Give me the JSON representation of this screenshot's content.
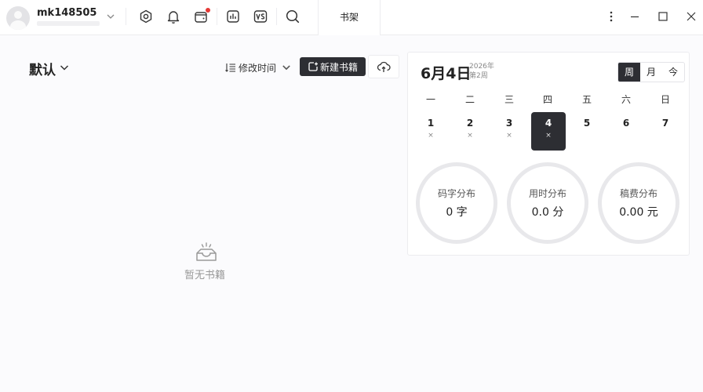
{
  "header": {
    "username": "mk148505",
    "tab_label": "书架",
    "notification_dot_color": "#e53935",
    "icons": [
      "settings-icon",
      "bell-icon",
      "wallet-icon",
      "stats-icon",
      "vs-icon",
      "search-icon"
    ]
  },
  "shelf": {
    "title": "默认",
    "sort_label": "修改时间",
    "new_book_label": "新建书籍",
    "empty_text": "暂无书籍"
  },
  "calendar": {
    "date": "6月4日",
    "year": "2026年",
    "week": "第2周",
    "view_options": [
      "周",
      "月",
      "今"
    ],
    "active_view": "周",
    "weekdays": [
      "一",
      "二",
      "三",
      "四",
      "五",
      "六",
      "日"
    ],
    "days": [
      {
        "num": "1",
        "mark": "×"
      },
      {
        "num": "2",
        "mark": "×"
      },
      {
        "num": "3",
        "mark": "×"
      },
      {
        "num": "4",
        "mark": "×"
      },
      {
        "num": "5",
        "mark": ""
      },
      {
        "num": "6",
        "mark": ""
      },
      {
        "num": "7",
        "mark": ""
      }
    ],
    "selected_day": "4"
  },
  "stats": [
    {
      "label": "码字分布",
      "value": "0 字"
    },
    {
      "label": "用时分布",
      "value": "0.0 分"
    },
    {
      "label": "稿费分布",
      "value": "0.00 元"
    }
  ],
  "colors": {
    "accent_dark": "#2d2e33",
    "background": "#fbfbfd"
  }
}
